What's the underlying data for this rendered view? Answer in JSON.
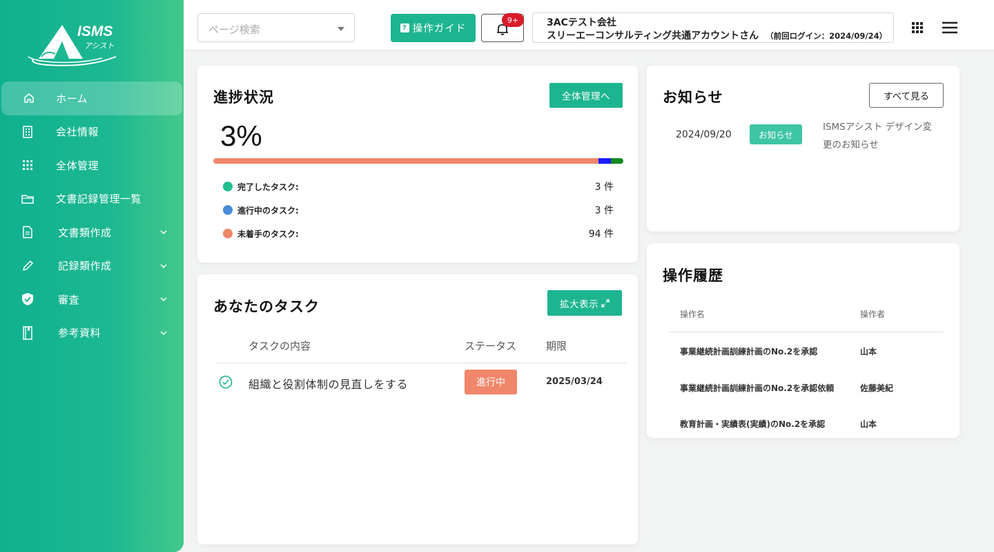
{
  "brand": {
    "logo_text": "ISMS",
    "logo_sub": "アシスト"
  },
  "sidebar": {
    "items": [
      {
        "label": "ホーム",
        "icon": "home-icon",
        "active": true
      },
      {
        "label": "会社情報",
        "icon": "building-icon"
      },
      {
        "label": "全体管理",
        "icon": "grid-icon"
      },
      {
        "label": "文書記録管理一覧",
        "icon": "folder-icon"
      },
      {
        "label": "文書類作成",
        "icon": "document-icon",
        "expandable": true
      },
      {
        "label": "記録類作成",
        "icon": "pencil-icon",
        "expandable": true
      },
      {
        "label": "審査",
        "icon": "shield-check-icon",
        "expandable": true
      },
      {
        "label": "参考資料",
        "icon": "book-icon",
        "expandable": true
      }
    ]
  },
  "header": {
    "search_placeholder": "ページ検索",
    "guide_label": "操作ガイド",
    "notification_badge": "9+",
    "company": "3ACテスト会社",
    "account_name": "スリーエーコンサルティング共通アカウントさん",
    "last_login": "（前回ログイン：2024/09/24）"
  },
  "progress": {
    "title": "進捗状況",
    "button": "全体管理へ",
    "percent": "3%",
    "bar_fractions": {
      "not_started": 0.94,
      "in_progress": 0.03,
      "completed": 0.03
    },
    "legend": [
      {
        "label": "完了したタスク:",
        "count": "3 件",
        "color": "#1fbf8f"
      },
      {
        "label": "進行中のタスク:",
        "count": "3 件",
        "color": "#4a8ad8"
      },
      {
        "label": "未着手のタスク:",
        "count": "94 件",
        "color": "#f0866a"
      }
    ],
    "bar_colors": {
      "not_started": "#f0866a",
      "in_progress": "#1a1aff",
      "completed": "#138a1e"
    }
  },
  "tasks": {
    "title": "あなたのタスク",
    "button": "拡大表示",
    "columns": [
      "タスクの内容",
      "ステータス",
      "期限"
    ],
    "rows": [
      {
        "content": "組織と役割体制の見直しをする",
        "status": "進行中",
        "due": "2025/03/24"
      }
    ]
  },
  "news": {
    "title": "お知らせ",
    "button": "すべて見る",
    "items": [
      {
        "date": "2024/09/20",
        "tag": "お知らせ",
        "text_line1": "ISMSアシスト デザイン変",
        "text_line2": "更のお知らせ"
      }
    ]
  },
  "history": {
    "title": "操作履歴",
    "columns": [
      "操作名",
      "操作者"
    ],
    "rows": [
      {
        "operation": "事業継続計画訓練計画のNo.2を承認",
        "user": "山本"
      },
      {
        "operation": "事業継続計画訓練計画のNo.2を承認依頼",
        "user": "佐藤美紀"
      },
      {
        "operation": "教育計画・実績表(実績)のNo.2を承認",
        "user": "山本"
      }
    ]
  },
  "colors": {
    "accent": "#1db58f",
    "status_in_progress": "#f0866a"
  }
}
